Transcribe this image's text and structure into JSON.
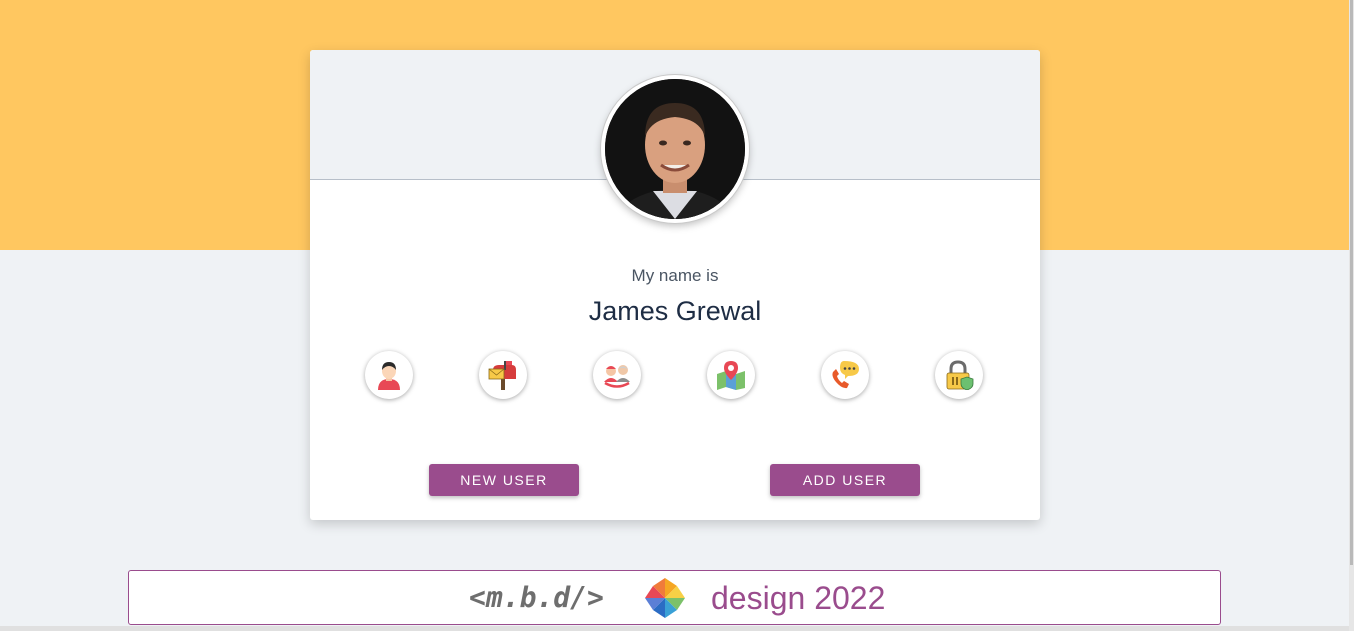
{
  "profile": {
    "label": "My name is",
    "name": "James Grewal"
  },
  "icons": [
    {
      "name": "user-icon"
    },
    {
      "name": "mailbox-icon"
    },
    {
      "name": "age-icon"
    },
    {
      "name": "map-location-icon"
    },
    {
      "name": "phone-icon"
    },
    {
      "name": "password-lock-icon"
    }
  ],
  "buttons": {
    "new_user": "NEW USER",
    "add_user": "ADD USER"
  },
  "footer": {
    "code": "<m.b.d/>",
    "text": "design 2022"
  },
  "colors": {
    "accent": "#9a4c8d",
    "top_band": "#ffc760",
    "background": "#eff2f5"
  }
}
